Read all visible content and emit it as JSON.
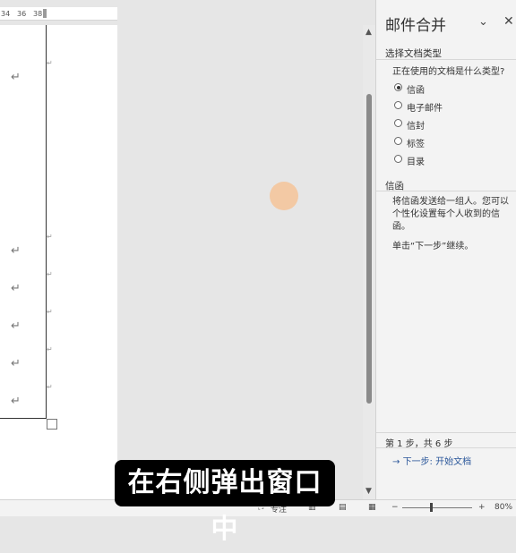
{
  "ruler": {
    "marks": [
      "34",
      "36",
      "38"
    ]
  },
  "document": {
    "paragraph_mark": "↵",
    "small_mark": "↵"
  },
  "pane": {
    "title": "邮件合并",
    "section_type_heading": "选择文档类型",
    "question": "正在使用的文档是什么类型?",
    "options": [
      {
        "label": "信函",
        "selected": true
      },
      {
        "label": "电子邮件",
        "selected": false
      },
      {
        "label": "信封",
        "selected": false
      },
      {
        "label": "标签",
        "selected": false
      },
      {
        "label": "目录",
        "selected": false
      }
    ],
    "section_letter_heading": "信函",
    "description": "将信函发送给一组人。您可以个性化设置每个人收到的信函。",
    "hint": "单击“下一步”继续。",
    "step_text": "第 1 步，共 6 步",
    "next_link": "下一步: 开始文档"
  },
  "status_bar": {
    "focus_label": "专注",
    "zoom_minus": "−",
    "zoom_plus": "+",
    "zoom_level": "80%"
  },
  "caption": "在右侧弹出窗口中",
  "colors": {
    "link": "#2b579a",
    "circle": "#f3c9a4"
  }
}
